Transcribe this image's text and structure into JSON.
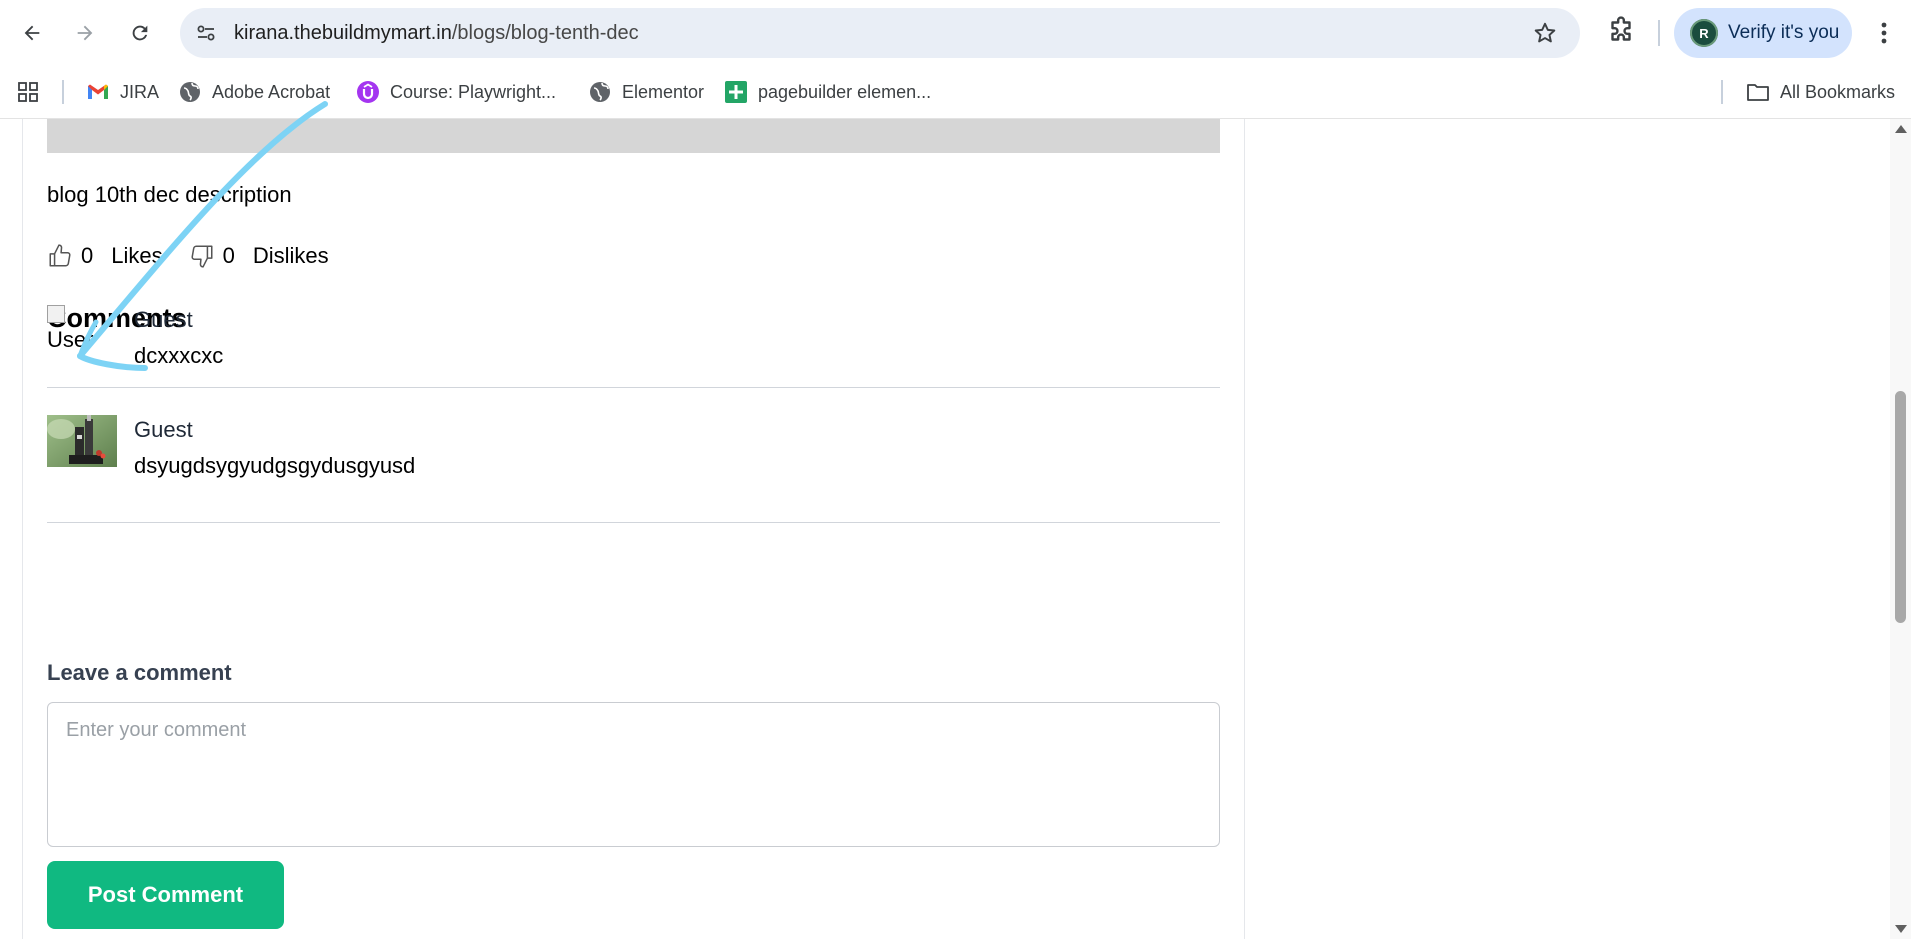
{
  "browser": {
    "url_host": "kirana.thebuildmymart.in",
    "url_path": "/blogs/blog-tenth-dec",
    "profile_initial": "R",
    "verify_label": "Verify it's you",
    "icons": [
      "back-arrow-icon",
      "forward-arrow-icon",
      "reload-icon",
      "site-info-icon",
      "star-icon",
      "extensions-icon",
      "more-vert-icon"
    ]
  },
  "bookmarks": {
    "items": [
      {
        "label": "JIRA",
        "icon": "gmail-icon"
      },
      {
        "label": "Adobe Acrobat",
        "icon": "globe-icon"
      },
      {
        "label": "Course: Playwright...",
        "icon": "udemy-icon"
      },
      {
        "label": "Elementor",
        "icon": "globe-icon"
      },
      {
        "label": "pagebuilder elemen...",
        "icon": "sheets-icon"
      }
    ],
    "all_bookmarks_label": "All Bookmarks"
  },
  "post": {
    "description": "blog 10th dec description",
    "likes_count": "0",
    "likes_label": "Likes",
    "dislikes_count": "0",
    "dislikes_label": "Dislikes"
  },
  "comments": {
    "heading": "Comments",
    "items": [
      {
        "author": "Guest",
        "text": "dcxxxcxc",
        "avatar_alt": "User",
        "avatar_broken": true
      },
      {
        "author": "Guest",
        "text": "dsyugdsygyudgsgydusgyusd",
        "avatar_alt": "User",
        "avatar_broken": false
      }
    ]
  },
  "comment_form": {
    "heading": "Leave a comment",
    "placeholder": "Enter your comment",
    "value": "",
    "submit_label": "Post Comment"
  },
  "colors": {
    "accent_green": "#10b981",
    "annotation_blue": "#7dd3f5",
    "omnibox_bg": "#e9eef6",
    "verify_chip_bg": "#d3e3fd"
  }
}
